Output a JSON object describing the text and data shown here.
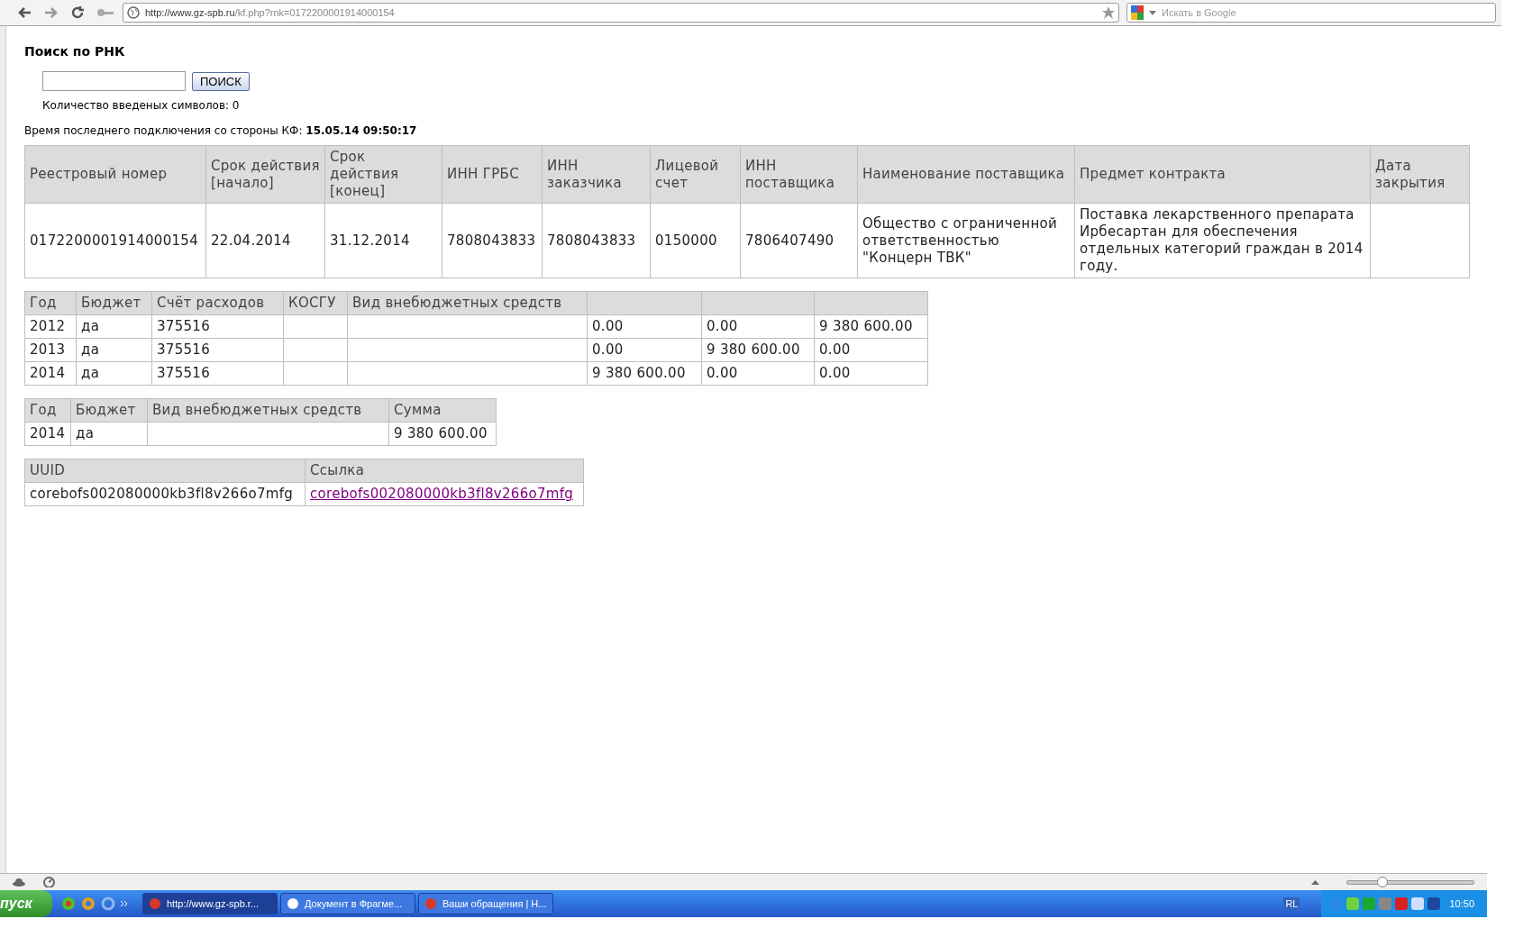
{
  "browser": {
    "url_host": "http://www.gz-spb.ru",
    "url_path": "/kf.php?rnk=0172200001914000154",
    "search_placeholder": "Искать в Google",
    "zoom": {
      "level": 0.27
    }
  },
  "search": {
    "title": "Поиск по РНК",
    "button": "ПОИСК",
    "counter": "Количество введеных символов: 0"
  },
  "last_connection": {
    "label": "Время последнего подключения со стороны КФ:",
    "value": "15.05.14 09:50:17"
  },
  "contract_table": {
    "columns": [
      "Реестровый номер",
      "Срок действия [начало]",
      "Срок действия [конец]",
      "ИНН ГРБС",
      "ИНН заказчика",
      "Лицевой счет",
      "ИНН поставщика",
      "Наименование поставщика",
      "Предмет контракта",
      "Дата закрытия"
    ],
    "rows": [
      [
        "0172200001914000154",
        "22.04.2014",
        "31.12.2014",
        "7808043833",
        "7808043833",
        "0150000",
        "7806407490",
        "Общество с ограниченной ответственностью \"Концерн ТВК\"",
        "Поставка лекарственного препарата Ирбесартан для обеспечения отдельных категорий граждан в 2014 году.",
        ""
      ]
    ]
  },
  "finance_table": {
    "columns": [
      "Год",
      "Бюджет",
      "Счёт расходов",
      "КОСГУ",
      "Вид внебюджетных средств",
      "",
      "",
      ""
    ],
    "rows": [
      [
        "2012",
        "да",
        "375516",
        "",
        "",
        "0.00",
        "0.00",
        "9 380 600.00"
      ],
      [
        "2013",
        "да",
        "375516",
        "",
        "",
        "0.00",
        "9 380 600.00",
        "0.00"
      ],
      [
        "2014",
        "да",
        "375516",
        "",
        "",
        "9 380 600.00",
        "0.00",
        "0.00"
      ]
    ]
  },
  "sum_table": {
    "columns": [
      "Год",
      "Бюджет",
      "Вид внебюджетных средств",
      "Сумма"
    ],
    "rows": [
      [
        "2014",
        "да",
        "",
        "9 380 600.00"
      ]
    ]
  },
  "uuid_table": {
    "columns": [
      "UUID",
      "Ссылка"
    ],
    "rows": [
      {
        "uuid": "corebofs002080000kb3fl8v266o7mfg",
        "link": "corebofs002080000kb3fl8v266o7mfg"
      }
    ]
  },
  "taskbar": {
    "start": "пуск",
    "tasks": [
      {
        "label": "http://www.gz-spb.r...",
        "selected": true
      },
      {
        "label": "Документ в Фрагме...",
        "selected": false
      },
      {
        "label": "Ваши обращения | Н...",
        "selected": false
      }
    ],
    "language": "RL",
    "clock": "10:50"
  }
}
